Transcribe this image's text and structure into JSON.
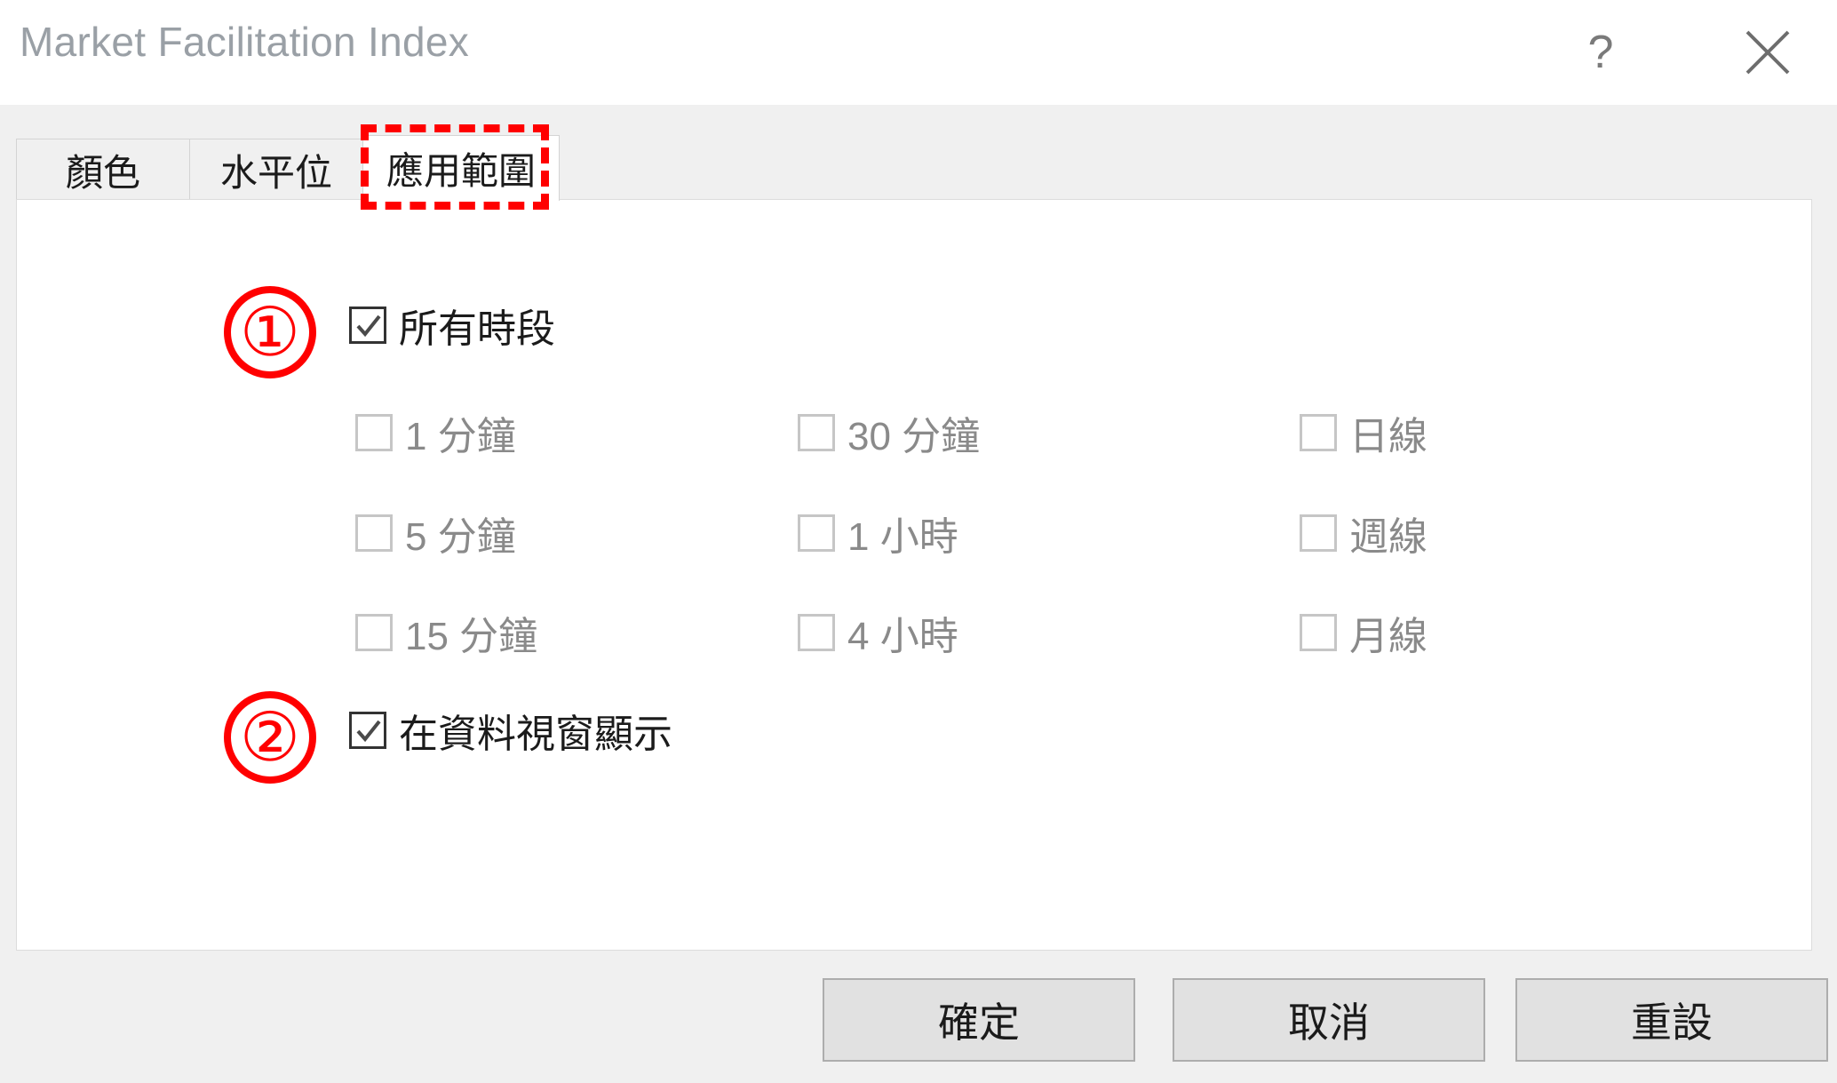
{
  "window": {
    "title": "Market Facilitation Index",
    "help_icon": "question-mark-icon",
    "close_icon": "close-icon"
  },
  "tabs": [
    {
      "label": "顏色",
      "active": false
    },
    {
      "label": "水平位",
      "active": false
    },
    {
      "label": "應用範圍",
      "active": true
    }
  ],
  "annotations": [
    {
      "label": "①",
      "target": "應用範圍 tab",
      "style": "red-dashed-rectangle"
    },
    {
      "label": "①",
      "target": "所有時段 checkbox",
      "style": "red-circle"
    },
    {
      "label": "②",
      "target": "在資料視窗顯示 checkbox",
      "style": "red-circle"
    }
  ],
  "annotation_numbers": {
    "one": "①",
    "two": "②"
  },
  "content": {
    "all_timeframes": {
      "label": "所有時段",
      "checked": true,
      "disabled": false
    },
    "timeframes": [
      {
        "label": "1 分鐘",
        "checked": false,
        "disabled": true
      },
      {
        "label": "30 分鐘",
        "checked": false,
        "disabled": true
      },
      {
        "label": "日線",
        "checked": false,
        "disabled": true
      },
      {
        "label": "5 分鐘",
        "checked": false,
        "disabled": true
      },
      {
        "label": "1 小時",
        "checked": false,
        "disabled": true
      },
      {
        "label": "週線",
        "checked": false,
        "disabled": true
      },
      {
        "label": "15 分鐘",
        "checked": false,
        "disabled": true
      },
      {
        "label": "4 小時",
        "checked": false,
        "disabled": true
      },
      {
        "label": "月線",
        "checked": false,
        "disabled": true
      }
    ],
    "show_in_data_window": {
      "label": "在資料視窗顯示",
      "checked": true,
      "disabled": false
    }
  },
  "footer": {
    "ok_label": "確定",
    "cancel_label": "取消",
    "reset_label": "重設"
  },
  "colors": {
    "annotation_red": "#ff0000",
    "dialog_background": "#f0f0f0",
    "panel_background": "#ffffff",
    "title_text": "#9aa0a6",
    "button_face": "#e1e1e1",
    "disabled_text": "#8a8a8a"
  }
}
